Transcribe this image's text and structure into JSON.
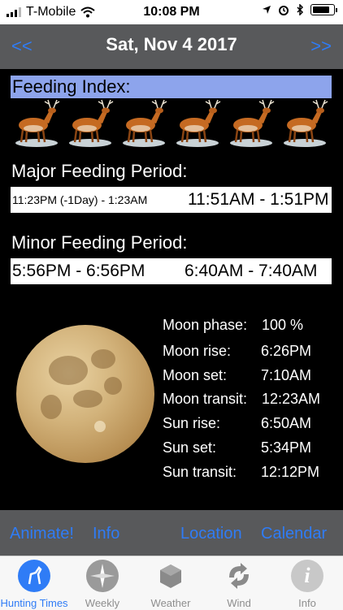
{
  "status_bar": {
    "carrier": "T-Mobile",
    "time": "10:08 PM"
  },
  "header": {
    "date": "Sat, Nov 4 2017",
    "prev": "<<",
    "next": ">>"
  },
  "feeding_index": {
    "label": "Feeding Index:",
    "rating": 6,
    "max": 6,
    "icon": "deer-icon"
  },
  "major": {
    "title": "Major Feeding Period:",
    "period1": "11:23PM (-1Day) - 1:23AM",
    "period2": "11:51AM - 1:51PM"
  },
  "minor": {
    "title": "Minor Feeding Period:",
    "period1": "5:56PM - 6:56PM",
    "period2": "6:40AM - 7:40AM"
  },
  "moon_info": [
    {
      "label": "Moon phase:",
      "value": "100 %"
    },
    {
      "label": "Moon rise:",
      "value": "6:26PM"
    },
    {
      "label": "Moon set:",
      "value": "7:10AM"
    },
    {
      "label": "Moon transit:",
      "value": "12:23AM"
    },
    {
      "label": "Sun rise:",
      "value": "6:50AM"
    },
    {
      "label": "Sun set:",
      "value": "5:34PM"
    },
    {
      "label": "Sun transit:",
      "value": "12:12PM"
    }
  ],
  "actions": {
    "animate": "Animate!",
    "info": "Info",
    "location": "Location",
    "calendar": "Calendar"
  },
  "tabs": [
    {
      "label": "Hunting Times",
      "icon": "hunting-times-icon",
      "active": true
    },
    {
      "label": "Weekly",
      "icon": "compass-icon",
      "active": false
    },
    {
      "label": "Weather",
      "icon": "cube-icon",
      "active": false
    },
    {
      "label": "Wind",
      "icon": "wind-arrows-icon",
      "active": false
    },
    {
      "label": "Info",
      "icon": "info-icon",
      "active": false
    }
  ],
  "colors": {
    "accent": "#2f7cf6",
    "bar": "#58595b",
    "highlight": "#8da4ec"
  }
}
